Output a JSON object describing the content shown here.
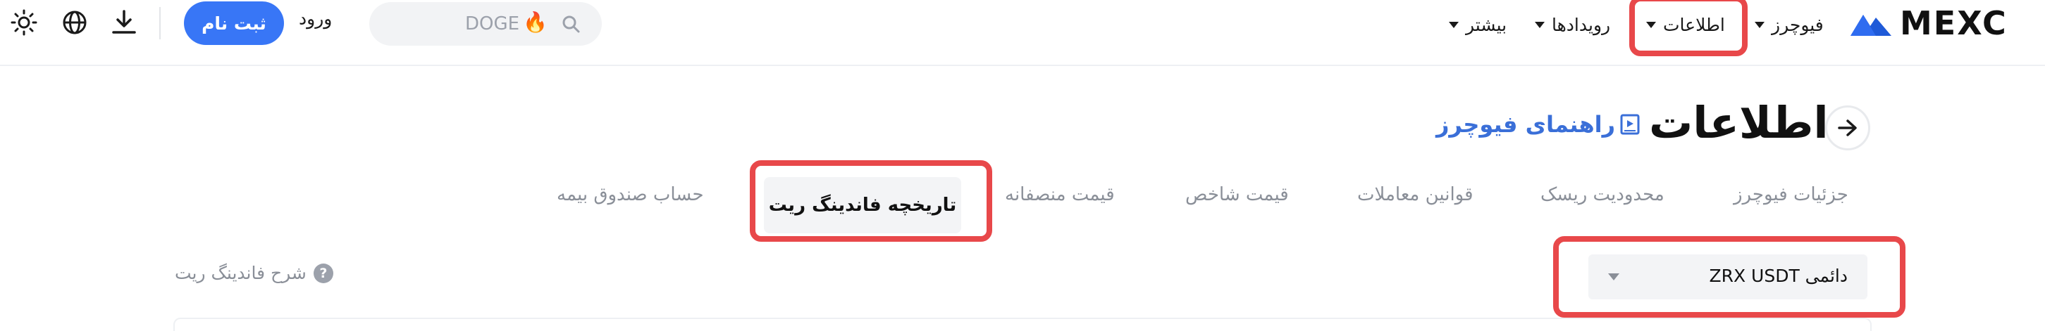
{
  "header": {
    "logo": {
      "text": "MEXC",
      "icon": "mexc-mountain-logo"
    },
    "nav": [
      {
        "label": "فیوچرز",
        "has_caret": true
      },
      {
        "label": "اطلاعات",
        "has_caret": true,
        "highlighted": true
      },
      {
        "label": "رویدادها",
        "has_caret": true
      },
      {
        "label": "بیشتر",
        "has_caret": true
      }
    ],
    "search": {
      "placeholder": "DOGE",
      "icons": [
        "search-icon",
        "fire-icon"
      ]
    },
    "login_label": "ورود",
    "signup_label": "ثبت نام",
    "icons": [
      "download-icon",
      "globe-icon",
      "theme-sun-icon"
    ]
  },
  "page": {
    "title": "اطلاعات",
    "guide_link": "راهنمای فیوچرز",
    "tabs": [
      {
        "label": "جزئیات فیوچرز"
      },
      {
        "label": "محدودیت ریسک"
      },
      {
        "label": "قوانین معاملات"
      },
      {
        "label": "قیمت شاخص"
      },
      {
        "label": "قیمت منصفانه"
      },
      {
        "label": "تاریخچه فاندینگ ریت",
        "active": true
      },
      {
        "label": "حساب صندوق بیمه"
      }
    ],
    "contract_select": {
      "value": "دائمی ZRX USDT"
    },
    "funding_explain": "شرح فاندینگ ریت",
    "help_symbol": "?"
  },
  "colors": {
    "accent_blue": "#3876f6",
    "link_blue": "#3a6fd8",
    "highlight_red": "#e8484a",
    "muted_text": "#8a8f98"
  }
}
